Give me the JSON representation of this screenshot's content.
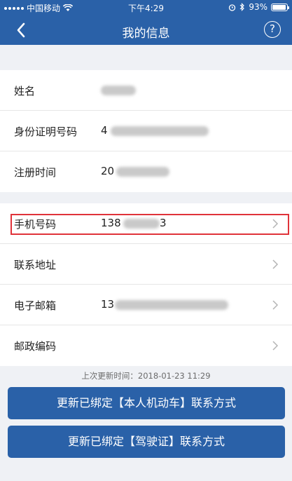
{
  "status_bar": {
    "carrier": "中国移动",
    "time": "下午4:29",
    "battery": "93%",
    "battery_level": 0.93
  },
  "nav": {
    "title": "我的信息",
    "back_icon": "chevron-left-icon",
    "help_icon": "question-circle-icon"
  },
  "profile": [
    {
      "label": "姓名",
      "value": "",
      "has_chevron": false
    },
    {
      "label": "身份证明号码",
      "value": "4",
      "has_chevron": false
    },
    {
      "label": "注册时间",
      "value": "20",
      "has_chevron": false
    }
  ],
  "contact": [
    {
      "label": "手机号码",
      "value": "138",
      "value_suffix": "3",
      "highlighted": true,
      "has_chevron": true
    },
    {
      "label": "联系地址",
      "value": "",
      "has_chevron": true
    },
    {
      "label": "电子邮箱",
      "value": "13",
      "has_chevron": true
    },
    {
      "label": "邮政编码",
      "value": "",
      "has_chevron": true
    }
  ],
  "last_update": "上次更新时间：2018-01-23 11:29",
  "buttons": {
    "update_vehicle": "更新已绑定【本人机动车】联系方式",
    "update_license": "更新已绑定【驾驶证】联系方式"
  },
  "colors": {
    "brand": "#2a61a8",
    "highlight": "#e0333a",
    "background": "#eff1f5"
  }
}
